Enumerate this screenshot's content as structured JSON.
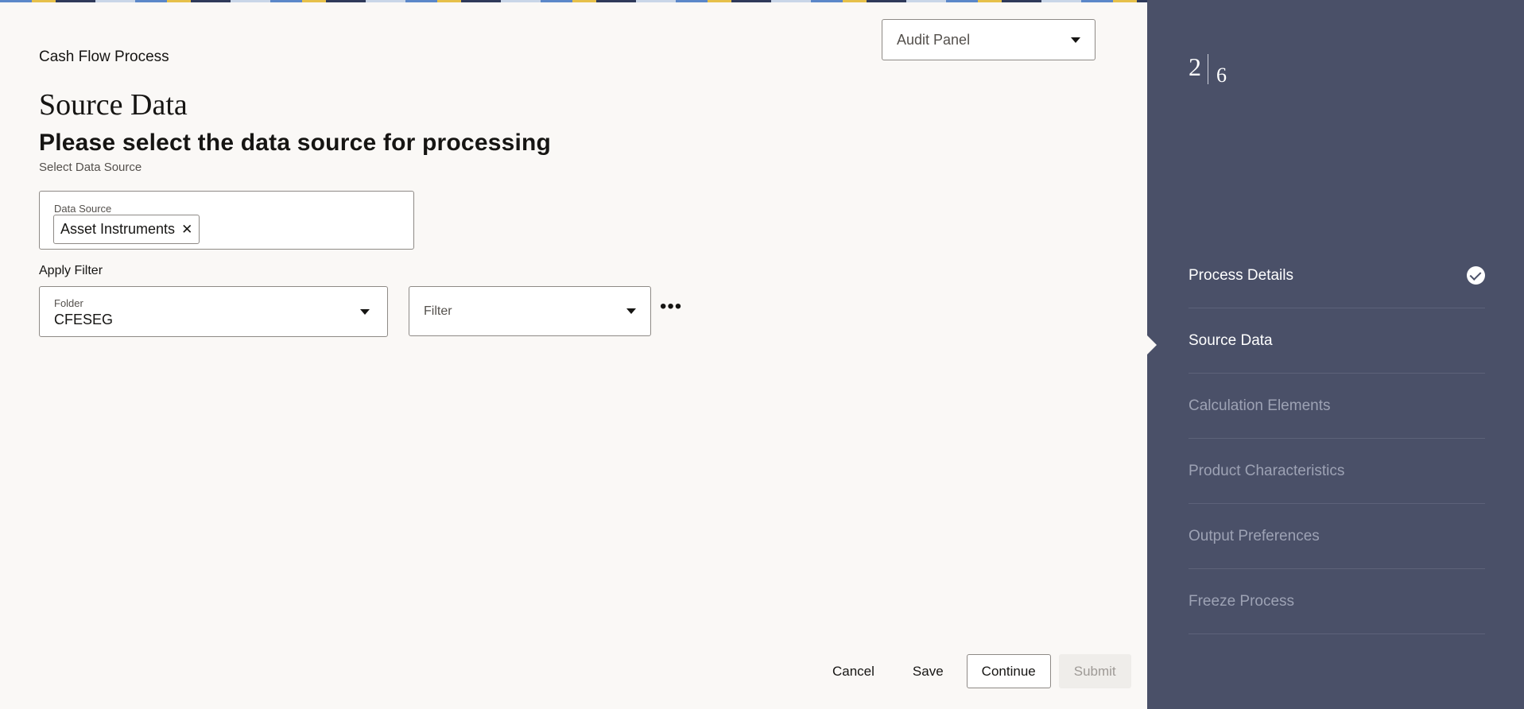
{
  "header": {
    "breadcrumb": "Cash Flow Process",
    "audit_panel": "Audit Panel"
  },
  "main": {
    "page_title": "Source Data",
    "subtitle": "Please select the data source for processing",
    "section_label": "Select Data Source",
    "data_source": {
      "label": "Data Source",
      "chip": "Asset Instruments",
      "remove_glyph": "✕"
    },
    "apply_filter": "Apply Filter",
    "folder": {
      "label": "Folder",
      "value": "CFESEG"
    },
    "filter": {
      "placeholder": "Filter"
    },
    "more": "•••"
  },
  "footer": {
    "cancel": "Cancel",
    "save": "Save",
    "continue": "Continue",
    "submit": "Submit"
  },
  "sidebar": {
    "current_step": "2",
    "total_steps": "6",
    "steps": [
      {
        "label": "Process Details",
        "state": "completed"
      },
      {
        "label": "Source Data",
        "state": "current"
      },
      {
        "label": "Calculation Elements",
        "state": "pending"
      },
      {
        "label": "Product Characteristics",
        "state": "pending"
      },
      {
        "label": "Output Preferences",
        "state": "pending"
      },
      {
        "label": "Freeze Process",
        "state": "pending"
      }
    ]
  },
  "icons": {
    "caret": "chevron-down-icon",
    "check": "check-circle-icon",
    "remove": "close-icon",
    "more": "more-horizontal-icon"
  },
  "colors": {
    "sidebar": "#4a5068",
    "page_bg": "#faf8f6",
    "text": "#161513"
  }
}
